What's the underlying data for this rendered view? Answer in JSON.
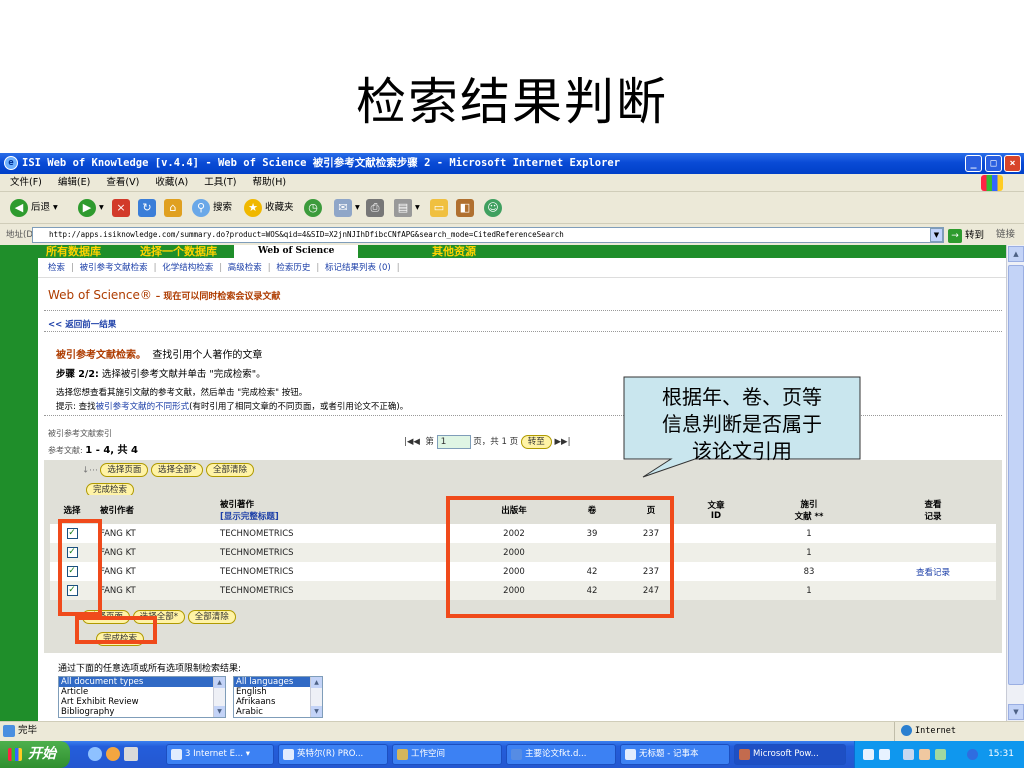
{
  "slide": {
    "title": "检索结果判断"
  },
  "window": {
    "title": "ISI Web of Knowledge [v.4.4] - Web of Science 被引参考文献检索步骤 2 - Microsoft Internet Explorer",
    "menu": [
      "文件(F)",
      "编辑(E)",
      "查看(V)",
      "收藏(A)",
      "工具(T)",
      "帮助(H)"
    ],
    "toolbar": {
      "back": "后退",
      "search": "搜索",
      "favorites": "收藏夹"
    },
    "address_label": "地址(D)",
    "url": "http://apps.isiknowledge.com/summary.do?product=WOS&qid=4&SID=X2jnNJIhDfibcCNfAPG&search_mode=CitedReferenceSearch",
    "go": "转到",
    "links": "链接"
  },
  "page": {
    "db_tabs": [
      "所有数据库",
      "选择一个数据库",
      "Web of Science",
      "其他资源"
    ],
    "subnav": [
      "检索",
      "被引参考文献检索",
      "化学结构检索",
      "高级检索",
      "检索历史",
      "标记结果列表 (0)"
    ],
    "wos_heading": "Web of Science®",
    "wos_subheading": "– 现在可以同时检索会议录文献",
    "back_link": "<< 返回前一结果",
    "crs_title": "被引参考文献检索。",
    "crs_subtitle": "查找引用个人著作的文章",
    "step_label": "步骤 2/2:",
    "step_text": "选择被引参考文献并单击 \"完成检索\"。",
    "desc1": "选择您想查看其施引文献的参考文献，然后单击 \"完成检索\" 按钮。",
    "desc2_prefix": "提示: 查找",
    "desc2_link": "被引参考文献的不同形式",
    "desc2_suffix": "(有时引用了相同文章的不同页面，或者引用论文不正确)。",
    "cited_label": "被引参考文献索引",
    "refs_label": "参考文献:",
    "refs_range": "1 - 4,  共  4",
    "pager_prefix": "第",
    "pager_page": "1",
    "pager_suffix": "页，共 1 页",
    "pager_go": "转至",
    "select_page": "选择页面",
    "select_all": "选择全部*",
    "clear_all": "全部清除",
    "done_search": "完成检索",
    "limit_text": "通过下面的任意选项或所有选项限制检索结果:",
    "doc_types": [
      "All document types",
      "Article",
      "Art Exhibit Review",
      "Bibliography"
    ],
    "languages": [
      "All languages",
      "English",
      "Afrikaans",
      "Arabic"
    ]
  },
  "table": {
    "headers": {
      "select": "选择",
      "author": "被引作者",
      "work": "被引著作",
      "work_link": "[显示完整标题]",
      "year": "出版年",
      "volume": "卷",
      "page": "页",
      "article_id_1": "文章",
      "article_id_2": "ID",
      "citing_1": "施引",
      "citing_2": "文献 **",
      "view_1": "查看",
      "view_2": "记录"
    },
    "rows": [
      {
        "checked": "✓",
        "author": "FANG KT",
        "work": "TECHNOMETRICS",
        "year": "2002",
        "volume": "39",
        "page": "237",
        "article_id": "",
        "citing": "1",
        "view": ""
      },
      {
        "checked": "✓",
        "author": "FANG KT",
        "work": "TECHNOMETRICS",
        "year": "2000",
        "volume": "",
        "page": "",
        "article_id": "",
        "citing": "1",
        "view": ""
      },
      {
        "checked": "✓",
        "author": "FANG KT",
        "work": "TECHNOMETRICS",
        "year": "2000",
        "volume": "42",
        "page": "237",
        "article_id": "",
        "citing": "83",
        "view": "查看记录"
      },
      {
        "checked": "✓",
        "author": "FANG KT",
        "work": "TECHNOMETRICS",
        "year": "2000",
        "volume": "42",
        "page": "247",
        "article_id": "",
        "citing": "1",
        "view": ""
      }
    ]
  },
  "status": {
    "text": "完毕",
    "zone": "Internet"
  },
  "taskbar": {
    "start": "开始",
    "tasks": [
      "3 Internet E...",
      "英特尔(R) PRO...",
      "工作空间",
      "主要论文fkt.d...",
      "无标题 - 记事本",
      "Microsoft Pow..."
    ],
    "clock": "15:31"
  },
  "callout": {
    "line1": "根据年、卷、页等",
    "line2": "信息判断是否属于",
    "line3": "该论文引用"
  },
  "colors": {
    "site_green": "#1f8e2a",
    "tab_yellow": "#ffd200",
    "highlight_red": "#f04a1b",
    "callout_fill": "#c9e6ee"
  }
}
